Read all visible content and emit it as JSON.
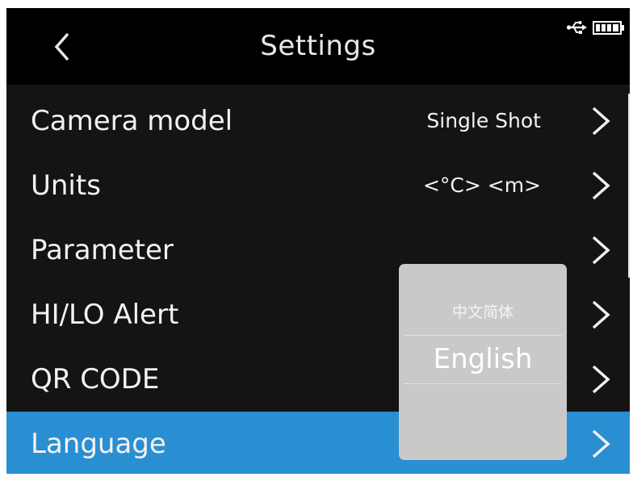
{
  "header": {
    "title": "Settings",
    "back_icon": "chevron-left-icon",
    "status_icons": [
      "usb-icon",
      "battery-icon"
    ]
  },
  "menu": {
    "items": [
      {
        "label": "Camera model",
        "value": "Single Shot",
        "selected": false
      },
      {
        "label": "Units",
        "value": "<°C> <m>",
        "selected": false
      },
      {
        "label": "Parameter",
        "value": "",
        "selected": false
      },
      {
        "label": "HI/LO Alert",
        "value": "",
        "selected": false
      },
      {
        "label": "QR CODE",
        "value": "",
        "selected": false
      },
      {
        "label": "Language",
        "value": "",
        "selected": true
      }
    ],
    "chevron_icon": "chevron-right-icon"
  },
  "language_popup": {
    "options": [
      "中文简体",
      "English"
    ],
    "selected": "English"
  },
  "colors": {
    "background": "#141414",
    "header": "#000000",
    "selection": "#2a8fd2",
    "popup": "#c9c9c9",
    "text": "#f2f2f2"
  }
}
